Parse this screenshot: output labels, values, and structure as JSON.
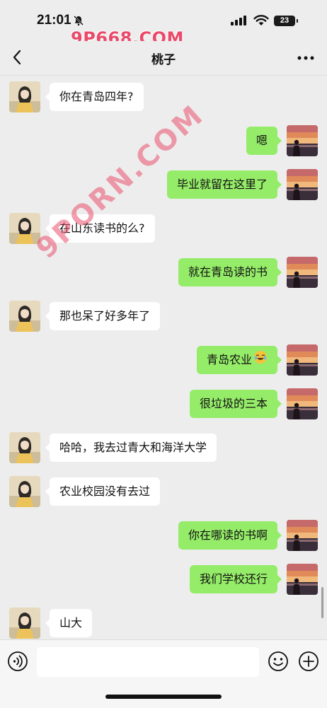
{
  "status_bar": {
    "time": "21:01",
    "battery": "23",
    "watermark": "9P668.COM"
  },
  "nav": {
    "title": "桃子"
  },
  "overlay_watermark": "9PORN.COM",
  "messages": [
    {
      "side": "left",
      "text": "你在青岛四年?"
    },
    {
      "side": "right",
      "text": "嗯"
    },
    {
      "side": "right",
      "text": "毕业就留在这里了"
    },
    {
      "side": "left",
      "text": "在山东读书的么?"
    },
    {
      "side": "right",
      "text": "就在青岛读的书"
    },
    {
      "side": "left",
      "text": "那也呆了好多年了"
    },
    {
      "side": "right",
      "text": "青岛农业",
      "emoji": "laughing-crying-emoji"
    },
    {
      "side": "right",
      "text": "很垃圾的三本"
    },
    {
      "side": "left",
      "text": "哈哈，我去过青大和海洋大学"
    },
    {
      "side": "left",
      "text": "农业校园没有去过"
    },
    {
      "side": "right",
      "text": "你在哪读的书啊"
    },
    {
      "side": "right",
      "text": "我们学校还行"
    },
    {
      "side": "left",
      "text": "山大"
    }
  ],
  "input": {
    "value": "",
    "placeholder": ""
  },
  "icons": {
    "back": "chevron-left-icon",
    "more": "more-dots-icon",
    "voice": "voice-icon",
    "emoji": "smiley-icon",
    "plus": "plus-icon",
    "mute": "bell-slash-icon"
  },
  "colors": {
    "background": "#ededed",
    "bubble_self": "#95ec69",
    "bubble_other": "#ffffff",
    "watermark": "#e94a6a"
  }
}
